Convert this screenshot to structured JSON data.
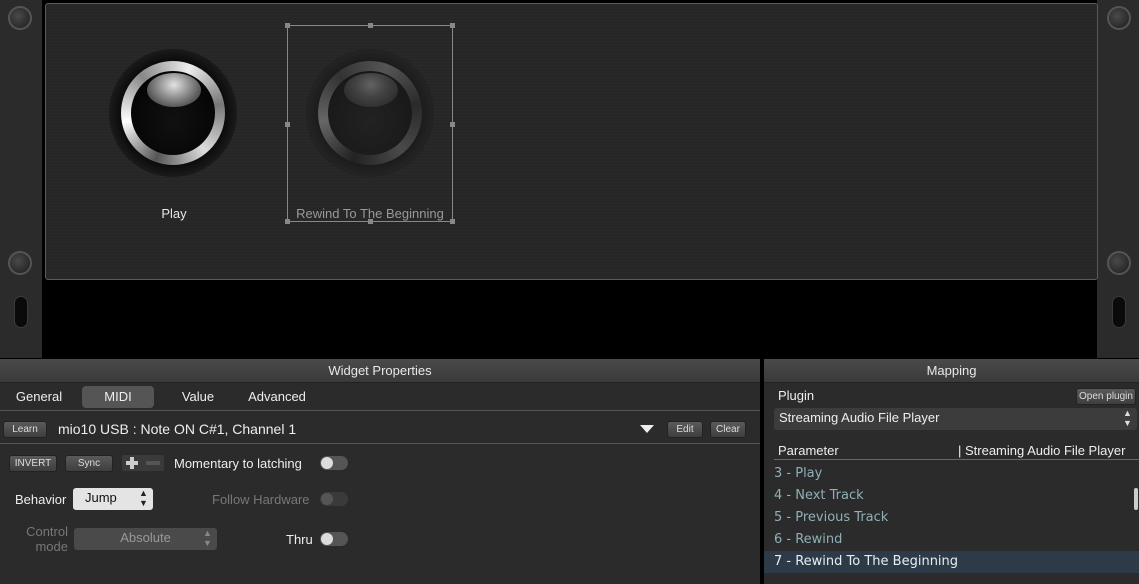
{
  "colors": {
    "background": "#000000",
    "panel": "#262626",
    "pane": "#2b2b2b",
    "selected_row": "#2d3a48",
    "param_text": "#8fb0b7"
  },
  "widgets": {
    "play": {
      "label": "Play",
      "icon": "play-knob"
    },
    "rewind": {
      "label": "Rewind To The Beginning",
      "icon": "rewind-knob"
    }
  },
  "widget_properties": {
    "title": "Widget Properties",
    "tabs": [
      "General",
      "MIDI",
      "Value",
      "Advanced"
    ],
    "active_tab": "MIDI",
    "learn_label": "Learn",
    "midi_assignment": "mio10 USB : Note ON C#1, Channel 1",
    "edit_label": "Edit",
    "clear_label": "Clear",
    "invert_label": "INVERT",
    "sync_label": "Sync",
    "momentary_label": "Momentary to latching",
    "behavior_label": "Behavior",
    "behavior_value": "Jump",
    "follow_hardware_label": "Follow Hardware",
    "control_mode_label": "Control mode",
    "control_mode_value": "Absolute",
    "thru_label": "Thru"
  },
  "mapping": {
    "title": "Mapping",
    "plugin_label": "Plugin",
    "open_plugin_label": "Open plugin",
    "plugin_value": "Streaming Audio File Player",
    "parameter_header": "Parameter",
    "plugin_header": "| Streaming Audio File Player",
    "parameters": [
      "3 - Play",
      "4 - Next Track",
      "5 - Previous Track",
      "6 - Rewind",
      "7 - Rewind To The Beginning"
    ],
    "selected_index": 4
  }
}
